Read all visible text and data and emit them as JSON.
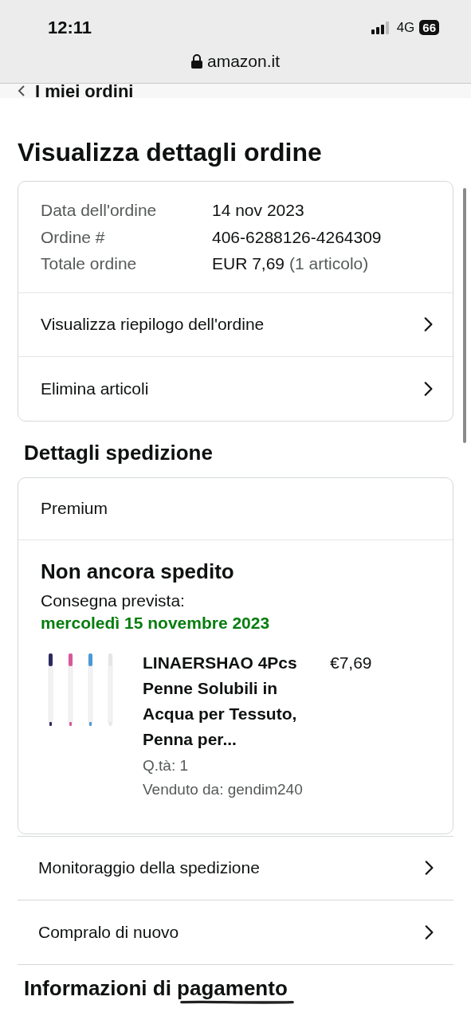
{
  "status_bar": {
    "time": "12:11",
    "network": "4G",
    "battery": "66"
  },
  "address_bar": {
    "url": "amazon.it"
  },
  "back_link": {
    "label": "I miei ordini"
  },
  "page_title": "Visualizza dettagli ordine",
  "order_summary": {
    "fields": [
      {
        "label": "Data dell'ordine",
        "value": "14 nov 2023"
      },
      {
        "label": "Ordine #",
        "value": "406-6288126-4264309"
      },
      {
        "label": "Totale ordine",
        "value": "EUR 7,69",
        "note": "(1 articolo)"
      }
    ],
    "links": [
      "Visualizza riepilogo dell'ordine",
      "Elimina articoli"
    ]
  },
  "shipping": {
    "heading": "Dettagli spedizione",
    "service": "Premium",
    "status": "Non ancora spedito",
    "delivery_label": "Consegna prevista:",
    "delivery_date": "mercoledì 15 novembre 2023",
    "item": {
      "kind": "picture",
      "title": "LINAERSHAO 4Pcs Penne Solubili in Acqua per Tessuto, Penna per...",
      "price": "€7,69",
      "quantity": "Q.tà: 1",
      "seller": "Venduto da: gendim240"
    }
  },
  "actions": [
    "Monitoraggio della spedizione",
    "Compralo di nuovo"
  ],
  "payment_heading": "Informazioni di pagamento"
}
